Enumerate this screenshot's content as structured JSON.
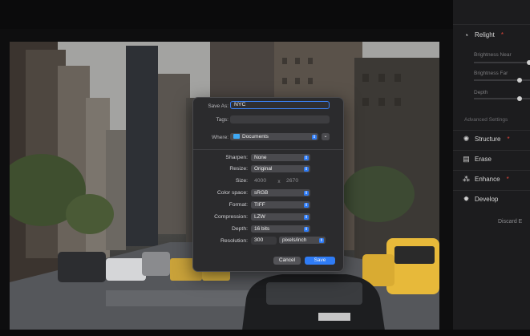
{
  "panel": {
    "sections": [
      {
        "name": "Relight",
        "icon": "relight-icon",
        "starred": true
      },
      {
        "name": "Structure",
        "icon": "structure-icon",
        "starred": true
      },
      {
        "name": "Erase",
        "icon": "erase-icon",
        "starred": false
      },
      {
        "name": "Enhance",
        "icon": "enhance-icon",
        "starred": true
      },
      {
        "name": "Develop",
        "icon": "develop-icon",
        "starred": false
      }
    ],
    "relight_sub": [
      "Brightness Near",
      "Brightness Far",
      "Depth"
    ],
    "relight_levels": [
      1.0,
      0.95,
      0.95
    ],
    "advanced": "Advanced Settings",
    "discard": "Discard E",
    "star_symbol": "*"
  },
  "dialog": {
    "save_as_label": "Save As:",
    "save_as_value": "NYC",
    "tags_label": "Tags:",
    "where_label": "Where:",
    "where_value": "Documents",
    "sharpen_label": "Sharpen:",
    "sharpen_value": "None",
    "resize_label": "Resize:",
    "resize_value": "Original",
    "size_label": "Size:",
    "size_w": "4000",
    "size_x": "x",
    "size_h": "2670",
    "colorspace_label": "Color space:",
    "colorspace_value": "sRGB",
    "format_label": "Format:",
    "format_value": "TIFF",
    "compression_label": "Compression:",
    "compression_value": "LZW",
    "depth_label": "Depth:",
    "depth_value": "16 bits",
    "resolution_label": "Resolution:",
    "resolution_value": "300",
    "resolution_unit": "pixels/inch",
    "cancel": "Cancel",
    "save": "Save"
  },
  "colors": {
    "accent": "#2f7cf6",
    "star": "#e0453a",
    "folder": "#3fa9f5"
  }
}
